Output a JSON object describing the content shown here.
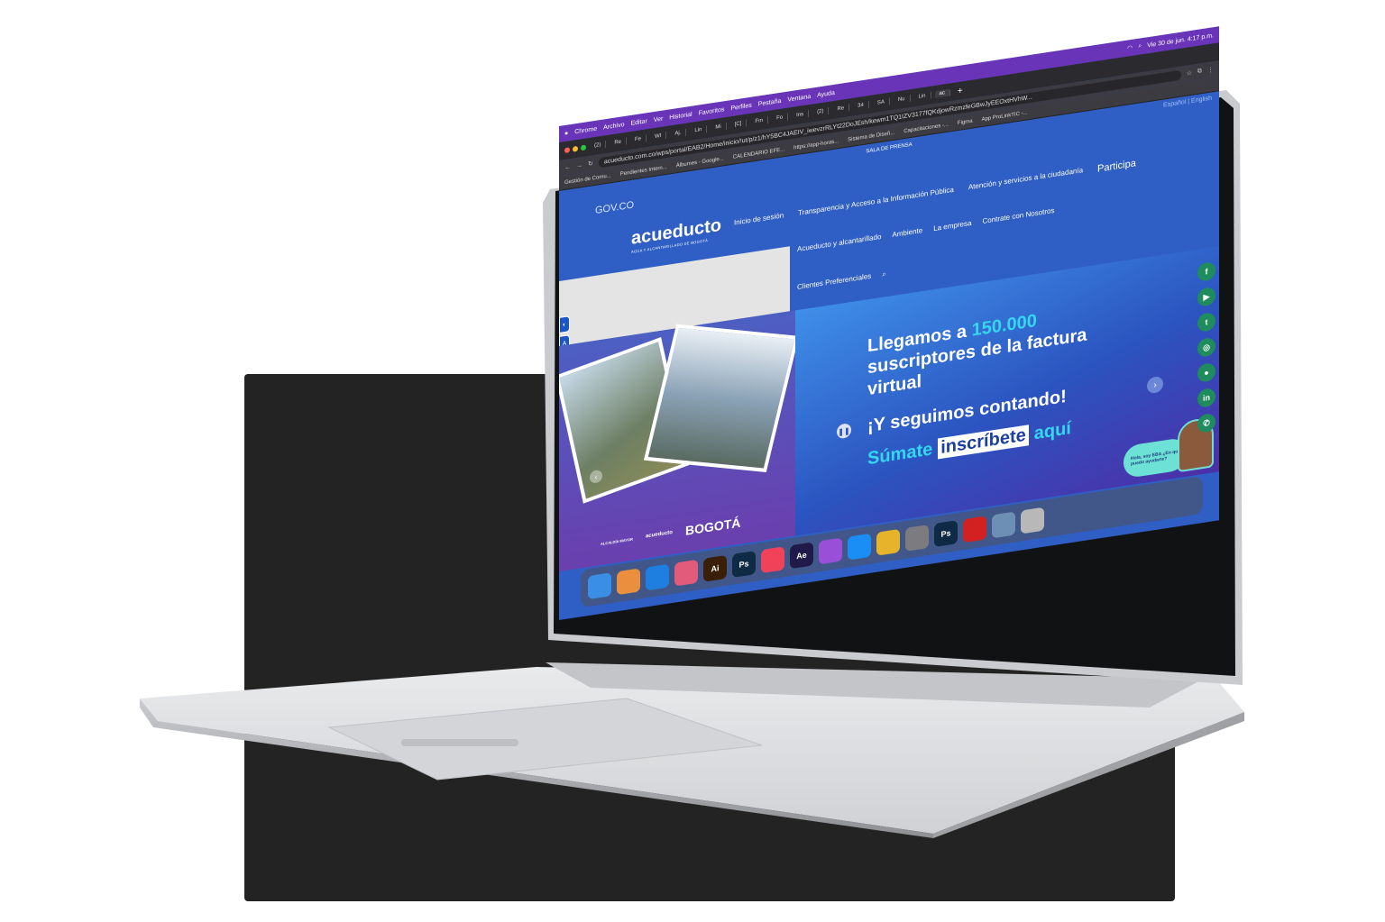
{
  "macos": {
    "menu": [
      "Chrome",
      "Archivo",
      "Editar",
      "Ver",
      "Historial",
      "Favoritos",
      "Perfiles",
      "Pestaña",
      "Ventana",
      "Ayuda"
    ],
    "clock": "Vie 30 de jun.  4:17 p.m."
  },
  "browser": {
    "tabs": [
      "(2)",
      "Re",
      "Fe",
      "WI",
      "Aj.",
      "Lin",
      "Mi",
      "[C]",
      "Fm",
      "Fo",
      "Ins",
      "(2)",
      "Re",
      "34",
      "SA",
      "Nu",
      "Lin",
      "ac"
    ],
    "url": "acueducto.com.co/wps/portal/EAB2/Home/inicio/!ut/p/z1/hY5BC4JAEIV_iwevzrRLYt22DoJEsh/kewm1TQ1IZV3177fQKdjowRzmzfeGBwJyEEOxtHVhW...",
    "bookmarks": [
      "Gestión de Comu...",
      "Pendientes Intern...",
      "Álbumes - Google...",
      "CALENDARIO EFE...",
      "https://app-horas...",
      "Sistema de Diseñ...",
      "Capacitaciones -...",
      "Figma",
      "App ProLinkTIC -..."
    ]
  },
  "page": {
    "sala_prensa": "SALA DE PRENSA",
    "languages": "Español | English",
    "gov": "GOV.CO",
    "logo": "acueducto",
    "logo_sub": "AGUA Y ALCANTARILLADO DE BOGOTÁ",
    "nav_top": [
      "Inicio de sesión",
      "Transparencia y Acceso a la Información Pública",
      "Atención y servicios a la ciudadanía"
    ],
    "nav_participa": "Participa",
    "nav_main": [
      "Acueducto y alcantarillado",
      "Ambiente",
      "La empresa",
      "Contrate con Nosotros"
    ],
    "nav_clients": "Clientes Preferenciales",
    "footer_logos": [
      "ALCALDÍA MAYOR",
      "acueducto",
      "BOGOTÁ"
    ]
  },
  "hero": {
    "line1_a": "Llegamos a ",
    "line1_highlight": "150.000",
    "line1_b": "suscriptores de la factura virtual",
    "line2": "¡Y seguimos contando!",
    "cta_a": "Súmate",
    "cta_box": "inscríbete",
    "cta_b": "aquí",
    "chat": "Hola, soy EBA ¿En qué puedo ayudarte?"
  },
  "social_icons": [
    "facebook-icon",
    "youtube-icon",
    "twitter-icon",
    "instagram-icon",
    "flickr-icon",
    "linkedin-icon",
    "whatsapp-icon"
  ],
  "dock_apps": [
    {
      "name": "finder",
      "label": "",
      "color": "#3a8ee6"
    },
    {
      "name": "launchpad",
      "label": "",
      "color": "#e98f3d"
    },
    {
      "name": "safari",
      "label": "",
      "color": "#1f7fe0"
    },
    {
      "name": "photos",
      "label": "",
      "color": "#e25b7b"
    },
    {
      "name": "illustrator",
      "label": "Ai",
      "color": "#3a1f08"
    },
    {
      "name": "photoshop",
      "label": "Ps",
      "color": "#0e2a44"
    },
    {
      "name": "music",
      "label": "",
      "color": "#f0435a"
    },
    {
      "name": "after-effects",
      "label": "Ae",
      "color": "#1f1a4a"
    },
    {
      "name": "podcasts",
      "label": "",
      "color": "#9a4fd8"
    },
    {
      "name": "app-store",
      "label": "",
      "color": "#1b8ef5"
    },
    {
      "name": "chrome",
      "label": "",
      "color": "#e7b32a"
    },
    {
      "name": "system-settings",
      "label": "",
      "color": "#7b7b80"
    },
    {
      "name": "photoshop-2",
      "label": "Ps",
      "color": "#0e2a44"
    },
    {
      "name": "acrobat",
      "label": "",
      "color": "#d32020"
    },
    {
      "name": "preview",
      "label": "",
      "color": "#6e8fb5"
    },
    {
      "name": "trash",
      "label": "",
      "color": "#b8b8b8"
    }
  ]
}
